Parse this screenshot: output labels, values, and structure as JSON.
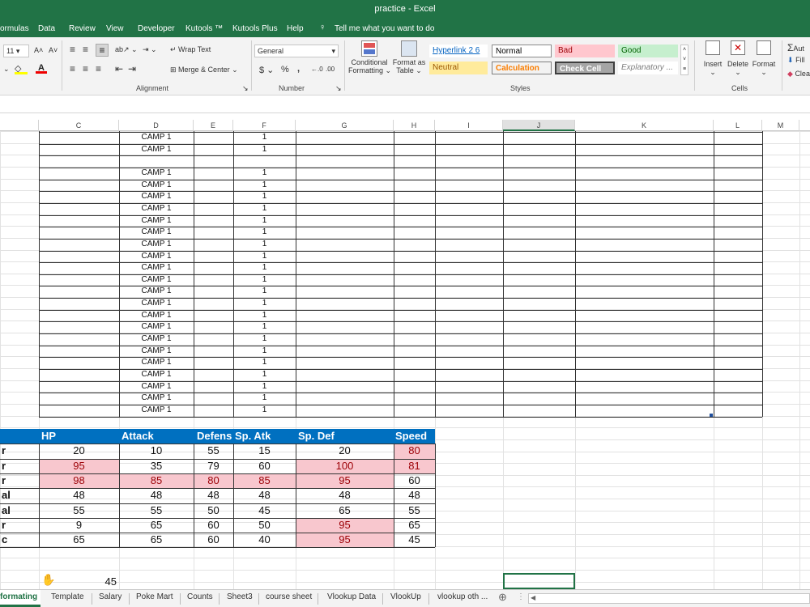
{
  "window": {
    "title": "practice  -  Excel"
  },
  "menu": [
    "ormulas",
    "Data",
    "Review",
    "View",
    "Developer",
    "Kutools ™",
    "Kutools Plus",
    "Help"
  ],
  "tell_me": "Tell me what you want to do",
  "ribbon": {
    "font_size": "11",
    "wrap_text": "Wrap Text",
    "merge_center": "Merge & Center",
    "number_format": "General",
    "currency": "$",
    "percent": "%",
    "comma": ",",
    "inc_dec": ".00 →.0",
    "conditional_formatting": [
      "Conditional",
      "Formatting"
    ],
    "format_as_table": [
      "Format as",
      "Table"
    ],
    "styles": {
      "hyperlink": "Hyperlink 2 6",
      "normal": "Normal",
      "bad": "Bad",
      "good": "Good",
      "neutral": "Neutral",
      "calculation": "Calculation",
      "check_cell": "Check Cell",
      "explanatory": "Explanatory ..."
    },
    "insert": "Insert",
    "delete": "Delete",
    "format": "Format",
    "autosum": "Aut",
    "fill": "Fill",
    "clear": "Clea",
    "groups": {
      "alignment": "Alignment",
      "number": "Number",
      "styles": "Styles",
      "cells": "Cells"
    }
  },
  "columns": [
    "C",
    "D",
    "E",
    "F",
    "G",
    "H",
    "I",
    "J",
    "K",
    "L",
    "M"
  ],
  "upper_rows": [
    {
      "d": "CAMP 1",
      "f": "1"
    },
    {
      "d": "CAMP 1",
      "f": "1"
    },
    {
      "d": "",
      "f": ""
    },
    {
      "d": "CAMP 1",
      "f": "1"
    },
    {
      "d": "CAMP 1",
      "f": "1"
    },
    {
      "d": "CAMP 1",
      "f": "1"
    },
    {
      "d": "CAMP 1",
      "f": "1"
    },
    {
      "d": "CAMP 1",
      "f": "1"
    },
    {
      "d": "CAMP 1",
      "f": "1"
    },
    {
      "d": "CAMP 1",
      "f": "1"
    },
    {
      "d": "CAMP 1",
      "f": "1"
    },
    {
      "d": "CAMP 1",
      "f": "1"
    },
    {
      "d": "CAMP 1",
      "f": "1"
    },
    {
      "d": "CAMP 1",
      "f": "1"
    },
    {
      "d": "CAMP 1",
      "f": "1"
    },
    {
      "d": "CAMP 1",
      "f": "1"
    },
    {
      "d": "CAMP 1",
      "f": "1"
    },
    {
      "d": "CAMP 1",
      "f": "1"
    },
    {
      "d": "CAMP 1",
      "f": "1"
    },
    {
      "d": "CAMP 1",
      "f": "1"
    },
    {
      "d": "CAMP 1",
      "f": "1"
    },
    {
      "d": "CAMP 1",
      "f": "1"
    },
    {
      "d": "CAMP 1",
      "f": "1"
    },
    {
      "d": "CAMP 1",
      "f": "1"
    }
  ],
  "stats_header": [
    "HP",
    "Attack",
    "Defens",
    "Sp. Atk",
    "Sp. Def",
    "Speed"
  ],
  "stats_rows": [
    {
      "label": "r",
      "values": [
        "20",
        "10",
        "55",
        "15",
        "20",
        "80"
      ],
      "hl": [
        false,
        false,
        false,
        false,
        false,
        true
      ]
    },
    {
      "label": "r",
      "values": [
        "95",
        "35",
        "79",
        "60",
        "100",
        "81"
      ],
      "hl": [
        true,
        false,
        false,
        false,
        true,
        true
      ]
    },
    {
      "label": "r",
      "values": [
        "98",
        "85",
        "80",
        "85",
        "95",
        "60"
      ],
      "hl": [
        true,
        true,
        true,
        true,
        true,
        false
      ]
    },
    {
      "label": "al",
      "values": [
        "48",
        "48",
        "48",
        "48",
        "48",
        "48"
      ],
      "hl": [
        false,
        false,
        false,
        false,
        false,
        false
      ]
    },
    {
      "label": "al",
      "values": [
        "55",
        "55",
        "50",
        "45",
        "65",
        "55"
      ],
      "hl": [
        false,
        false,
        false,
        false,
        false,
        false
      ]
    },
    {
      "label": "r",
      "values": [
        "9",
        "65",
        "60",
        "50",
        "95",
        "65"
      ],
      "hl": [
        false,
        false,
        false,
        false,
        true,
        false
      ]
    },
    {
      "label": "c",
      "values": [
        "65",
        "65",
        "60",
        "40",
        "95",
        "45"
      ],
      "hl": [
        false,
        false,
        false,
        false,
        true,
        false
      ]
    }
  ],
  "bottom_value": "45",
  "tabs": [
    "formating",
    "Template",
    "Salary",
    "Poke Mart",
    "Counts",
    "Sheet3",
    "course sheet",
    "Vlookup Data",
    "VlookUp",
    "vlookup oth ..."
  ],
  "active_tab": "formating",
  "colors": {
    "excel_green": "#217346",
    "table_header": "#0070c0",
    "bad_fill": "#f8c7ce",
    "bad_text": "#9c0006"
  }
}
